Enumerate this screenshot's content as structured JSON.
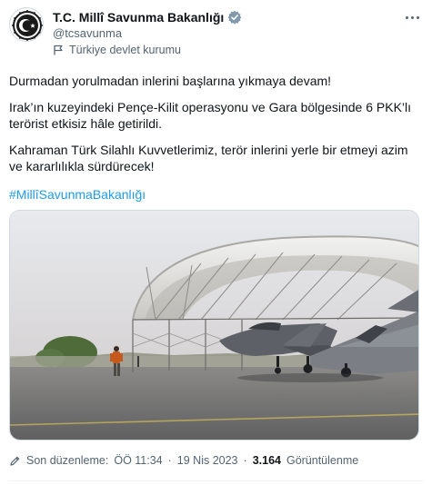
{
  "account": {
    "name": "T.C. Millî Savunma Bakanlığı",
    "handle": "@tcsavunma",
    "affiliation": "Türkiye devlet kurumu"
  },
  "tweet": {
    "line1": "Durmadan yorulmadan inlerini başlarına yıkmaya devam!",
    "line2": "Irak’ın kuzeyindeki Pençe-Kilit operasyonu ve Gara bölgesinde 6 PKK’lı terörist etkisiz hâle getirildi.",
    "line3": "Kahraman Türk Silahlı Kuvvetlerimiz, terör inlerini yerle bir etmeyi azim ve kararlılıkla sürdürecek!",
    "hashtag": "#MillîSavunmaBakanlığı"
  },
  "meta": {
    "edited_label": "Son düzenleme:",
    "time": "ÖÖ 11:34",
    "separator": "·",
    "date": "19 Nis 2023",
    "views_count": "3.164",
    "views_label": "Görüntülenme"
  },
  "colors": {
    "accent": "#1d9bf0",
    "secondary_text": "#536471",
    "verified_badge": "#829aab"
  },
  "icons": {
    "verified": "verified-badge-icon",
    "affiliation": "flag-icon",
    "more": "more-options-icon",
    "edited": "pencil-icon"
  }
}
